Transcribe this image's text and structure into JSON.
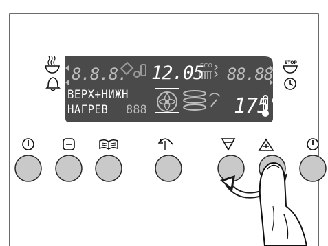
{
  "display": {
    "program_line1": "ВЕРХ+НИЖН",
    "program_line2": "НАГРЕВ",
    "time": "12.05",
    "temperature": "175°",
    "eco_label": "ECO",
    "inactive_left_segments": "8.8.8.",
    "inactive_right_segments": "88.88",
    "inactive_mid_segments": "888"
  },
  "icons": {
    "cooking_time_symbol": "steam-bowl-icon",
    "alarm_symbol": "bell-icon",
    "end_time_symbol": "stop-bowl-icon",
    "end_time_label": "STOP",
    "clock_symbol": "clock-icon"
  },
  "buttons": [
    {
      "symbol": "power-icon"
    },
    {
      "symbol": "menu-icon"
    },
    {
      "symbol": "recipe-book-icon"
    },
    {
      "symbol": "back-icon"
    },
    {
      "symbol": "minus-icon"
    },
    {
      "symbol": "plus-icon"
    },
    {
      "symbol": "timer-icon"
    }
  ],
  "gesture": {
    "action": "press and hold plus while rotating toward minus",
    "highlight_color": "#1a1a1a"
  },
  "colors": {
    "display_background": "#4a4a4a",
    "display_text": "#ffffff",
    "button_fill": "#c9c9c9",
    "outline": "#2a2a2a"
  }
}
